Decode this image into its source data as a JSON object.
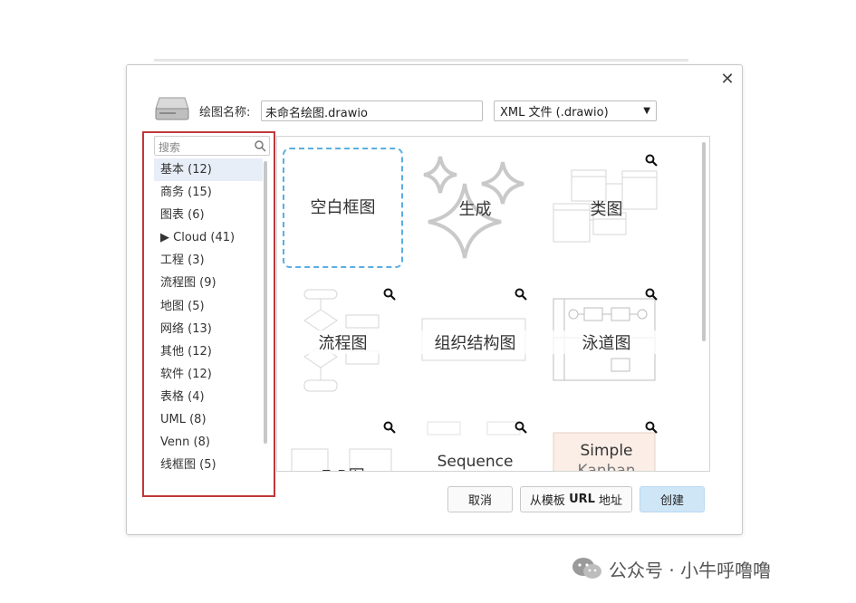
{
  "dialog": {
    "name_label": "绘图名称:",
    "name_value": "未命名绘图.drawio",
    "format_value": "XML 文件 (.drawio)",
    "close_icon": "close-icon"
  },
  "sidebar": {
    "search_placeholder": "搜索",
    "categories": [
      {
        "label": "基本 (12)",
        "selected": true
      },
      {
        "label": "商务 (15)"
      },
      {
        "label": "图表 (6)"
      },
      {
        "label": "▶  Cloud (41)"
      },
      {
        "label": "工程 (3)"
      },
      {
        "label": "流程图 (9)"
      },
      {
        "label": "地图 (5)"
      },
      {
        "label": "网络 (13)"
      },
      {
        "label": "其他 (12)"
      },
      {
        "label": "软件 (12)"
      },
      {
        "label": "表格 (4)"
      },
      {
        "label": "UML (8)"
      },
      {
        "label": "Venn (8)"
      },
      {
        "label": "线框图 (5)"
      }
    ]
  },
  "templates": {
    "blank": "空白框图",
    "generate": "生成",
    "class": "类图",
    "flowchart": "流程图",
    "orgchart": "组织结构图",
    "swimlane": "泳道图",
    "er": "E-R图",
    "sequence": "Sequence",
    "kanban_line1": "Simple",
    "kanban_line2": "Kanban"
  },
  "buttons": {
    "cancel": "取消",
    "from_url_prefix": "从模板 ",
    "from_url_bold": "URL",
    "from_url_suffix": " 地址",
    "create": "创建"
  },
  "watermark": "公众号 · 小牛呼噜噜",
  "colors": {
    "highlight_box": "#c0383a",
    "blank_dashed": "#5aaee0",
    "primary_button": "#cfe6f7"
  }
}
